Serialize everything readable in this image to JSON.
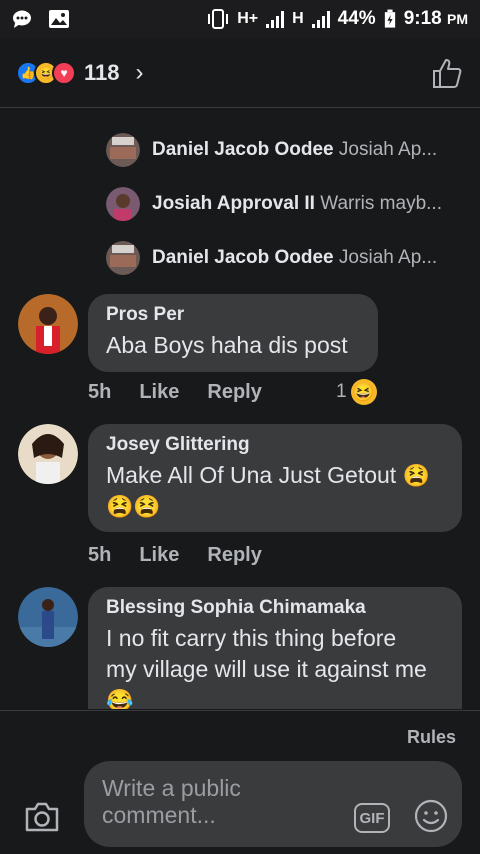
{
  "status_bar": {
    "network_left": "H+",
    "network_right": "H",
    "battery": "44%",
    "time": "9:18",
    "ampm": "PM"
  },
  "header": {
    "reaction_count": "118",
    "chevron": "›"
  },
  "replies": [
    {
      "name": "Daniel Jacob Oodee",
      "preview": "Josiah Ap..."
    },
    {
      "name": "Josiah Approval II",
      "preview": "Warris mayb..."
    },
    {
      "name": "Daniel Jacob Oodee",
      "preview": "Josiah Ap..."
    }
  ],
  "comments": [
    {
      "name": "Pros Per",
      "text": "Aba Boys haha dis post",
      "time": "5h",
      "like": "Like",
      "reply": "Reply",
      "reaction_count": "1"
    },
    {
      "name": "Josey Glittering",
      "text": "Make All Of Una Just Getout",
      "time": "5h",
      "like": "Like",
      "reply": "Reply"
    },
    {
      "name": "Blessing Sophia Chimamaka",
      "text_line1": "I no fit carry this thing before",
      "text_line2": "my village will use it against me"
    }
  ],
  "footer": {
    "rules": "Rules",
    "placeholder": "Write a public comment...",
    "gif": "GIF"
  },
  "colors": {
    "background": "#18191a",
    "bubble": "#3a3b3c",
    "text": "#e4e6eb",
    "muted": "#b0b3b8",
    "like_blue": "#1877f2",
    "haha_yellow": "#f7b928",
    "love_red": "#f33e58"
  },
  "icons": [
    "chat-bubble-icon",
    "image-icon",
    "vibrate-icon",
    "signal-icon",
    "battery-icon",
    "like-reaction-icon",
    "haha-reaction-icon",
    "love-reaction-icon",
    "chevron-right-icon",
    "thumbs-up-icon",
    "camera-icon",
    "gif-icon",
    "smiley-icon"
  ]
}
